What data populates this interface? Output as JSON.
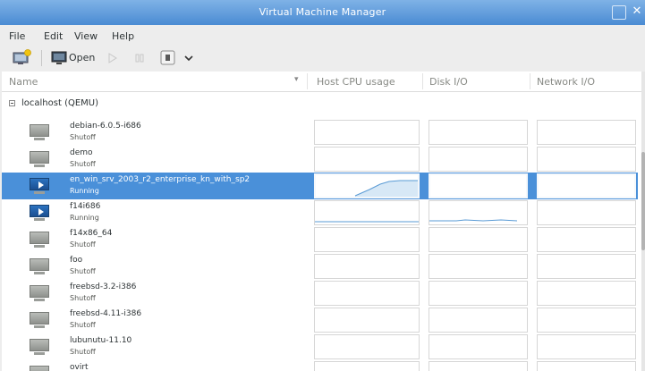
{
  "window": {
    "title": "Virtual Machine Manager"
  },
  "menu": {
    "file": "File",
    "edit": "Edit",
    "view": "View",
    "help": "Help"
  },
  "toolbar": {
    "open_label": "Open"
  },
  "columns": {
    "name": "Name",
    "cpu": "Host CPU usage",
    "disk": "Disk I/O",
    "net": "Network I/O"
  },
  "group": {
    "label": "localhost (QEMU)"
  },
  "vms": [
    {
      "name": "debian-6.0.5-i686",
      "status": "Shutoff",
      "state": "off"
    },
    {
      "name": "demo",
      "status": "Shutoff",
      "state": "off"
    },
    {
      "name": "en_win_srv_2003_r2_enterprise_kn_with_sp2",
      "status": "Running",
      "state": "running",
      "selected": true
    },
    {
      "name": "f14i686",
      "status": "Running",
      "state": "running"
    },
    {
      "name": "f14x86_64",
      "status": "Shutoff",
      "state": "off"
    },
    {
      "name": "foo",
      "status": "Shutoff",
      "state": "off"
    },
    {
      "name": "freebsd-3.2-i386",
      "status": "Shutoff",
      "state": "off"
    },
    {
      "name": "freebsd-4.11-i386",
      "status": "Shutoff",
      "state": "off"
    },
    {
      "name": "lubunutu-11.10",
      "status": "Shutoff",
      "state": "off"
    },
    {
      "name": "ovirt",
      "status": "",
      "state": "off"
    }
  ],
  "colors": {
    "accent": "#4a90d9",
    "graph_line": "#5a9bd5"
  }
}
